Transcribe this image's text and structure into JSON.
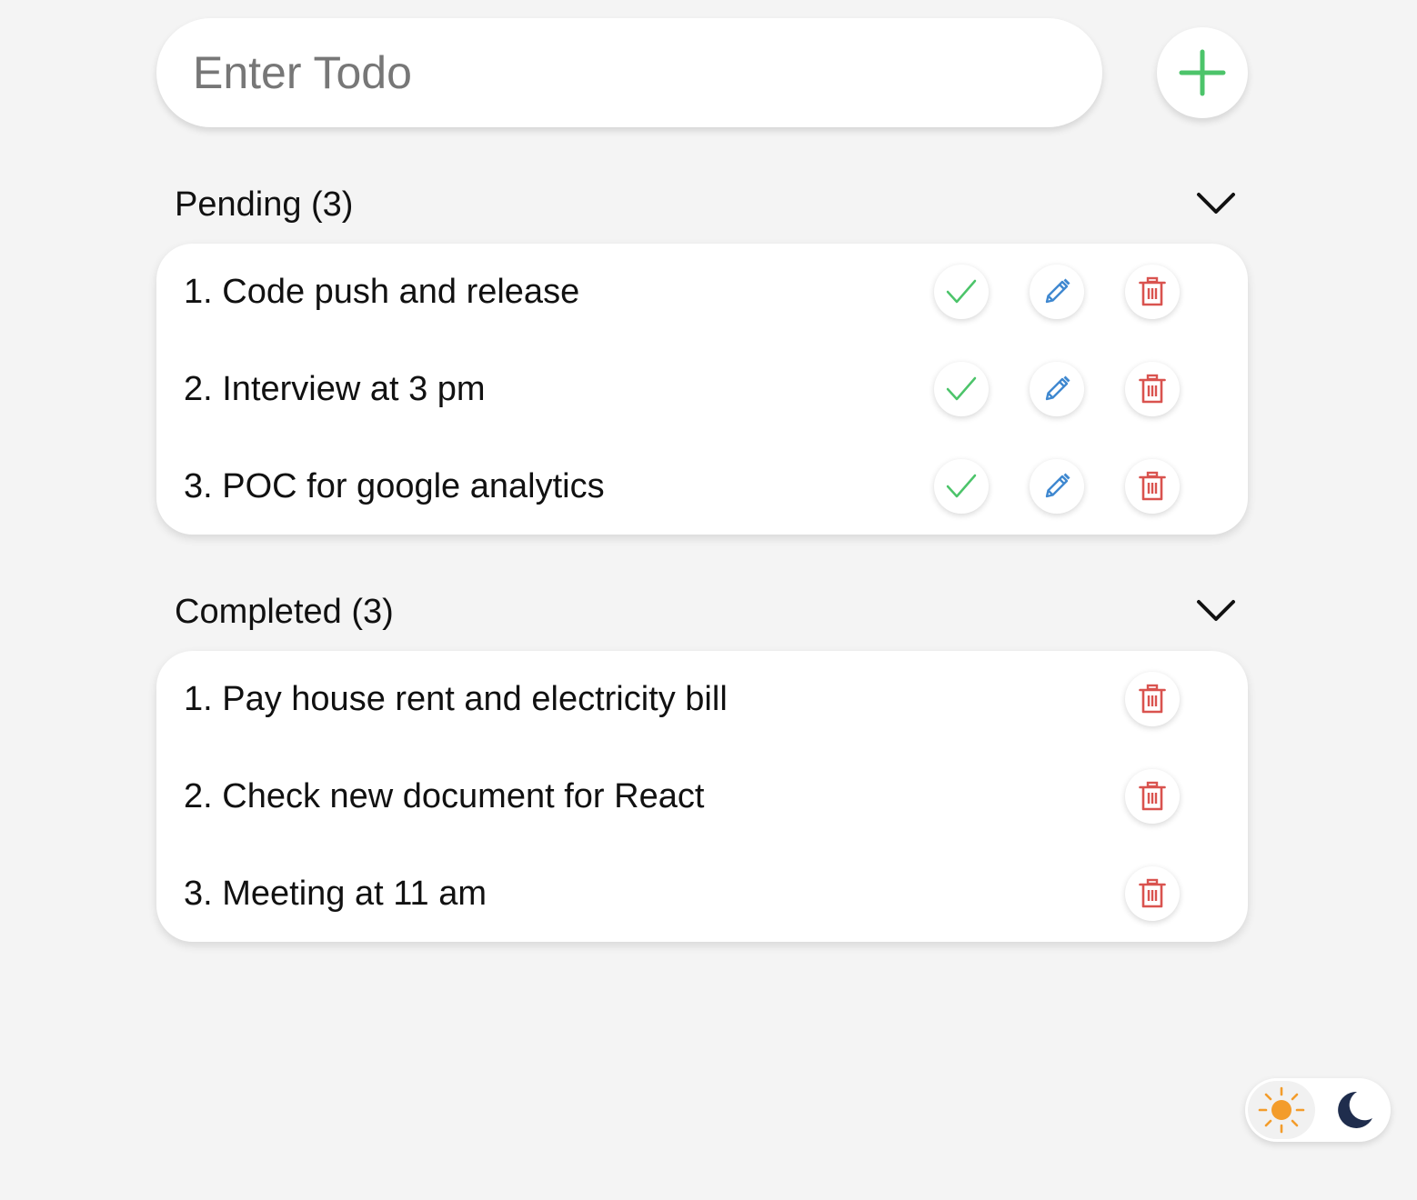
{
  "input": {
    "placeholder": "Enter Todo",
    "value": ""
  },
  "add_button": {
    "icon": "plus-icon",
    "color": "#4cc46a"
  },
  "pending": {
    "title": "Pending (3)",
    "icon": "chevron-down-icon",
    "items": [
      {
        "text": "1. Code push and release"
      },
      {
        "text": "2. Interview at 3 pm"
      },
      {
        "text": "3. POC for google analytics"
      }
    ]
  },
  "completed": {
    "title": "Completed (3)",
    "icon": "chevron-down-icon",
    "items": [
      {
        "text": "1. Pay house rent and electricity bill"
      },
      {
        "text": "2. Check new document for React"
      },
      {
        "text": "3. Meeting at 11 am"
      }
    ]
  },
  "icons": {
    "complete": "check-icon",
    "edit": "pencil-icon",
    "delete": "trash-icon"
  },
  "colors": {
    "background": "#f4f4f4",
    "check": "#4cc46a",
    "edit": "#3f88d0",
    "delete": "#d9534f",
    "sun": "#f39c2b",
    "moon": "#1f2d4d"
  },
  "theme_toggle": {
    "options": [
      "sun-icon",
      "moon-icon"
    ],
    "selected": "light"
  }
}
